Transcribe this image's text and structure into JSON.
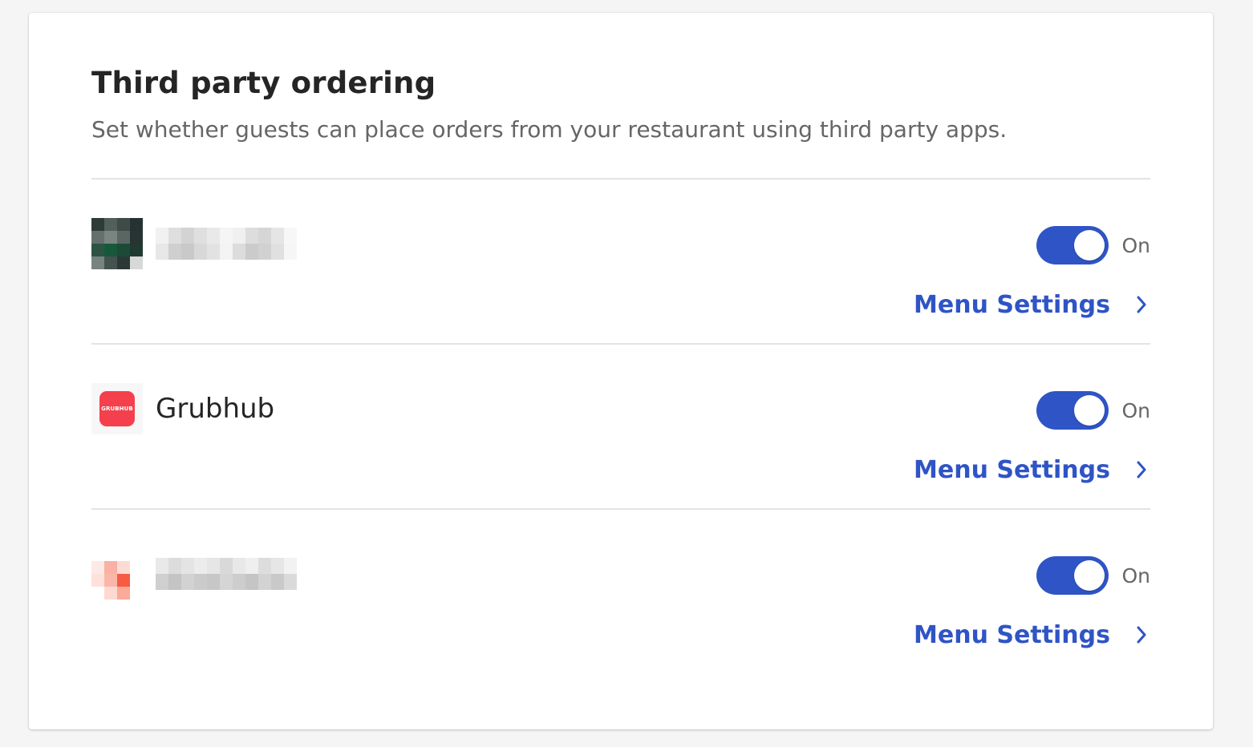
{
  "page": {
    "title": "Third party ordering",
    "subtitle": "Set whether guests can place orders from your restaurant using third party apps."
  },
  "providers": [
    {
      "name": "",
      "logo": "pixelated-logo-green-icon",
      "name_redacted": true,
      "toggle_state": "On",
      "menu_settings_label": "Menu Settings"
    },
    {
      "name": "Grubhub",
      "logo_text": "GRUBHUB",
      "logo": "grubhub-logo-icon",
      "name_redacted": false,
      "toggle_state": "On",
      "menu_settings_label": "Menu Settings"
    },
    {
      "name": "",
      "logo": "pixelated-logo-red-icon",
      "name_redacted": true,
      "toggle_state": "On",
      "menu_settings_label": "Menu Settings"
    }
  ],
  "colors": {
    "accent": "#2f54c6",
    "grubhub_red": "#f4404c",
    "divider": "#e3e3e3",
    "text_primary": "#252525",
    "text_secondary": "#666666"
  }
}
